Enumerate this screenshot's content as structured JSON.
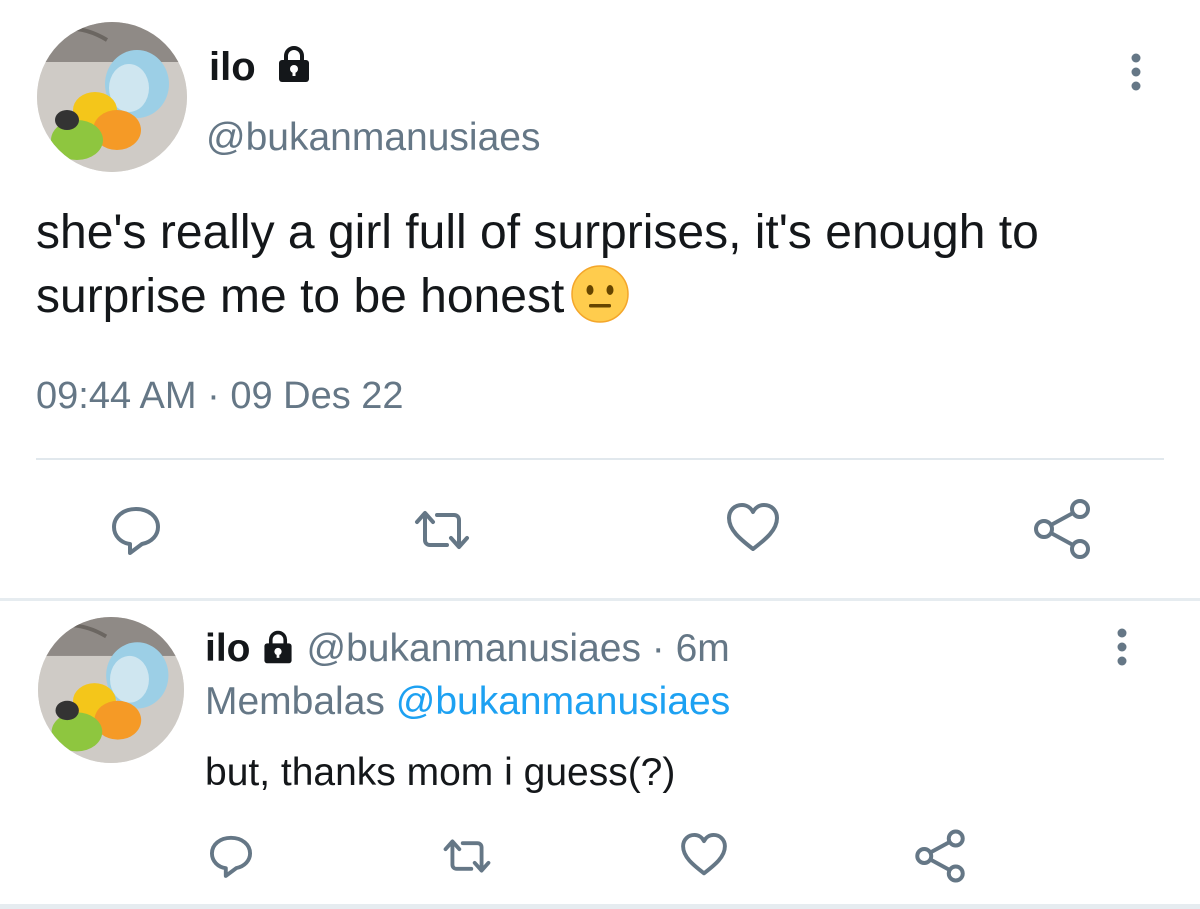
{
  "main_tweet": {
    "name": "ilo",
    "handle": "@bukanmanusiaes",
    "text": "she's really a girl full of surprises, it's enough to surprise me to be honest",
    "emoji": "neutral-face",
    "timestamp": "09:44 AM · 09 Des 22"
  },
  "reply": {
    "name": "ilo",
    "handle_time": "@bukanmanusiaes · 6m",
    "replying_to_label": "Membalas",
    "replying_to_handle": "@bukanmanusiaes",
    "text": "but, thanks mom i guess(?)"
  },
  "icons": {
    "verified_lock": "lock-icon",
    "more": "more-vertical-icon",
    "actions": [
      "reply-icon",
      "retweet-icon",
      "like-icon",
      "share-icon"
    ]
  },
  "colors": {
    "text": "#14171a",
    "secondary": "#657786",
    "link": "#1da1f2",
    "divider": "#e1e8ed"
  }
}
